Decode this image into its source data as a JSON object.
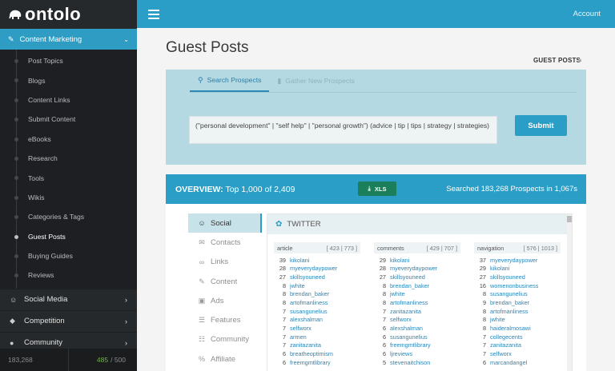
{
  "app": {
    "name": "ontolo"
  },
  "sidebar": {
    "active_section": "Content Marketing",
    "subitems": [
      "Post Topics",
      "Blogs",
      "Content Links",
      "Submit Content",
      "eBooks",
      "Research",
      "Tools",
      "Wikis",
      "Categories & Tags",
      "Guest Posts",
      "Buying Guides",
      "Reviews"
    ],
    "current_subitem": "Guest Posts",
    "sections": [
      {
        "label": "Social Media",
        "icon": "users-icon"
      },
      {
        "label": "Competition",
        "icon": "shield-icon"
      },
      {
        "label": "Community",
        "icon": "chat-icon"
      }
    ],
    "credits_left": "183,268",
    "credits_used": "485",
    "credits_total": "/ 500"
  },
  "topbar": {
    "account": "Account"
  },
  "page": {
    "title": "Guest Posts",
    "breadcrumb": "GUEST POSTS"
  },
  "search": {
    "tabs": [
      "Search Prospects",
      "Gather New Prospects"
    ],
    "query": "(\"personal development\" | \"self help\" | \"personal growth\") (advice | tip | tips | strategy | strategies)",
    "submit_label": "Submit"
  },
  "overview": {
    "label": "OVERVIEW:",
    "summary": "Top 1,000 of 2,409",
    "xls_label": "XLS",
    "stats": "Searched 183,268 Prospects in 1,067s"
  },
  "leftnav": [
    "Social",
    "Contacts",
    "Links",
    "Content",
    "Ads",
    "Features",
    "Community",
    "Affiliate"
  ],
  "social": {
    "header": "TWITTER",
    "columns": [
      {
        "name": "article",
        "counts": "[ 423 | 773 ]",
        "rows": [
          {
            "n": "39",
            "u": "kikolani"
          },
          {
            "n": "28",
            "u": "myeverydaypower"
          },
          {
            "n": "27",
            "u": "skillsyouneed"
          },
          {
            "n": "8",
            "u": "jwhite"
          },
          {
            "n": "8",
            "u": "brendan_baker"
          },
          {
            "n": "8",
            "u": "artofmanliness"
          },
          {
            "n": "7",
            "u": "susangunelius"
          },
          {
            "n": "7",
            "u": "alexshalman"
          },
          {
            "n": "7",
            "u": "selfworx"
          },
          {
            "n": "7",
            "u": "armen"
          },
          {
            "n": "7",
            "u": "zanitazanita"
          },
          {
            "n": "6",
            "u": "breatheoptimism"
          },
          {
            "n": "6",
            "u": "freemgmtlibrary"
          }
        ]
      },
      {
        "name": "comments",
        "counts": "[ 429 | 707 ]",
        "rows": [
          {
            "n": "29",
            "u": "kikolani"
          },
          {
            "n": "28",
            "u": "myeverydaypower"
          },
          {
            "n": "27",
            "u": "skillsyouneed"
          },
          {
            "n": "8",
            "u": "brendan_baker"
          },
          {
            "n": "8",
            "u": "jwhite"
          },
          {
            "n": "8",
            "u": "artofmanliness"
          },
          {
            "n": "7",
            "u": "zanitazanita"
          },
          {
            "n": "7",
            "u": "selfworx"
          },
          {
            "n": "6",
            "u": "alexshalman"
          },
          {
            "n": "6",
            "u": "susangunelius"
          },
          {
            "n": "6",
            "u": "freemgmtlibrary"
          },
          {
            "n": "6",
            "u": "ljreviews"
          },
          {
            "n": "5",
            "u": "stevenaitchison"
          }
        ]
      },
      {
        "name": "navigation",
        "counts": "[ 576 | 1013 ]",
        "rows": [
          {
            "n": "37",
            "u": "myeverydaypower"
          },
          {
            "n": "29",
            "u": "kikolani"
          },
          {
            "n": "27",
            "u": "skillsyouneed"
          },
          {
            "n": "16",
            "u": "womenonbusiness"
          },
          {
            "n": "8",
            "u": "susangunelius"
          },
          {
            "n": "9",
            "u": "brendan_baker"
          },
          {
            "n": "8",
            "u": "artofmanliness"
          },
          {
            "n": "8",
            "u": "jwhite"
          },
          {
            "n": "8",
            "u": "haideralmosawi"
          },
          {
            "n": "7",
            "u": "collegecents"
          },
          {
            "n": "7",
            "u": "zanitazanita"
          },
          {
            "n": "7",
            "u": "selfworx"
          },
          {
            "n": "6",
            "u": "marcandangel"
          }
        ]
      }
    ]
  }
}
